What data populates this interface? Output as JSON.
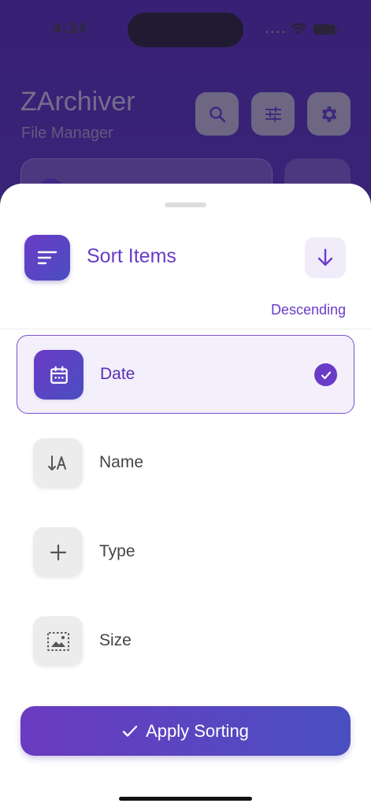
{
  "status_bar": {
    "time": "4:24"
  },
  "app": {
    "title": "ZArchiver",
    "subtitle": "File Manager"
  },
  "sheet": {
    "title": "Sort Items",
    "order_label": "Descending",
    "options": [
      {
        "label": "Date",
        "selected": true
      },
      {
        "label": "Name",
        "selected": false
      },
      {
        "label": "Type",
        "selected": false
      },
      {
        "label": "Size",
        "selected": false
      }
    ],
    "apply_label": "Apply Sorting"
  },
  "colors": {
    "accent": "#6a3bc7",
    "accent2": "#4b4ec0",
    "selected_bg": "#f3effb"
  }
}
